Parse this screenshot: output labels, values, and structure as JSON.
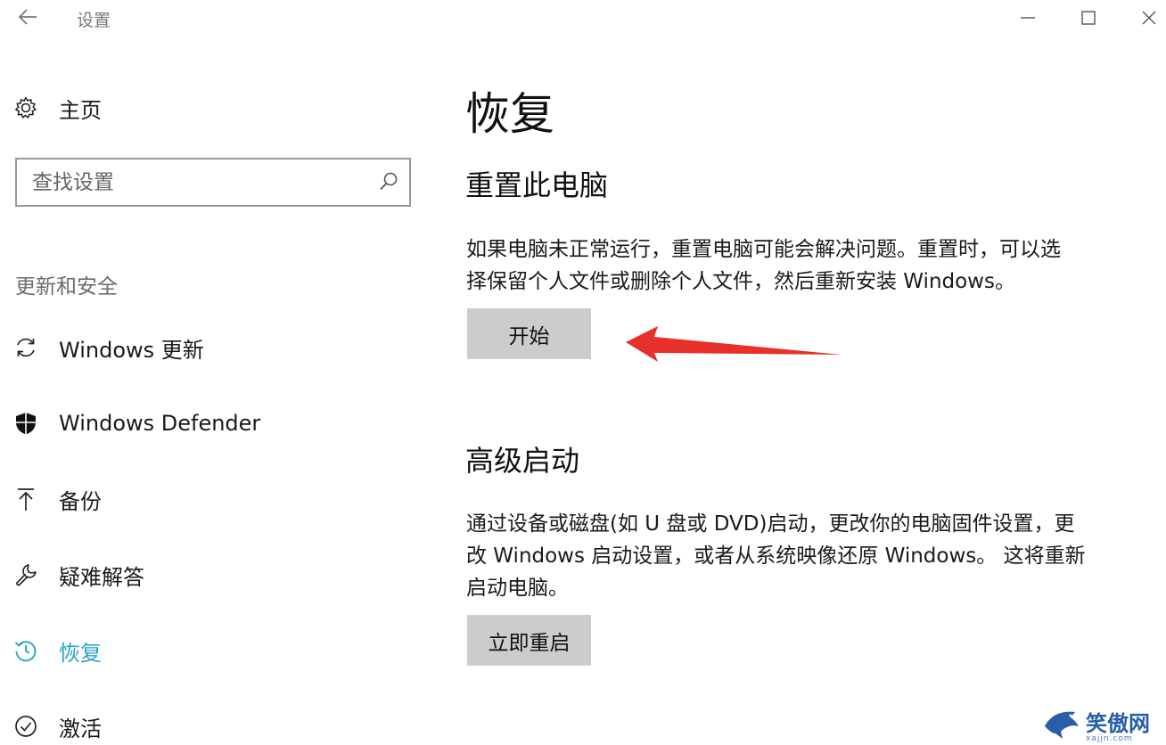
{
  "window": {
    "title": "设置",
    "back_icon": "back-arrow-icon",
    "controls": [
      "minimize-icon",
      "maximize-icon",
      "close-icon"
    ]
  },
  "sidebar": {
    "home": {
      "label": "主页",
      "icon": "gear-icon"
    },
    "search": {
      "placeholder": "查找设置",
      "value": "",
      "icon": "search-icon"
    },
    "section_heading": "更新和安全",
    "items": [
      {
        "label": "Windows 更新",
        "icon": "sync-icon",
        "active": false
      },
      {
        "label": "Windows Defender",
        "icon": "shield-icon",
        "active": false
      },
      {
        "label": "备份",
        "icon": "backup-arrow-icon",
        "active": false
      },
      {
        "label": "疑难解答",
        "icon": "wrench-icon",
        "active": false
      },
      {
        "label": "恢复",
        "icon": "history-icon",
        "active": true
      },
      {
        "label": "激活",
        "icon": "check-circle-icon",
        "active": false
      }
    ]
  },
  "main": {
    "title": "恢复",
    "reset_pc": {
      "title": "重置此电脑",
      "description_lines": [
        "如果电脑未正常运行，重置电脑可能会解决问题。重置时，可以选",
        "择保留个人文件或删除个人文件，然后重新安装 Windows。"
      ],
      "button_label": "开始"
    },
    "advanced_startup": {
      "title": "高级启动",
      "description_lines": [
        "通过设备或磁盘(如 U 盘或 DVD)启动，更改你的电脑固件设置，更",
        "改 Windows 启动设置，或者从系统映像还原 Windows。 这将重新",
        "启动电脑。"
      ],
      "button_label": "立即重启"
    }
  },
  "annotation": {
    "type": "red-arrow",
    "color": "#e8302a"
  },
  "watermark": {
    "text": "笑傲网",
    "subtext": "xajjn.com",
    "icon": "shark-logo-icon"
  },
  "colors": {
    "accent": "#2aa3c4",
    "button_bg": "#cccccc"
  }
}
